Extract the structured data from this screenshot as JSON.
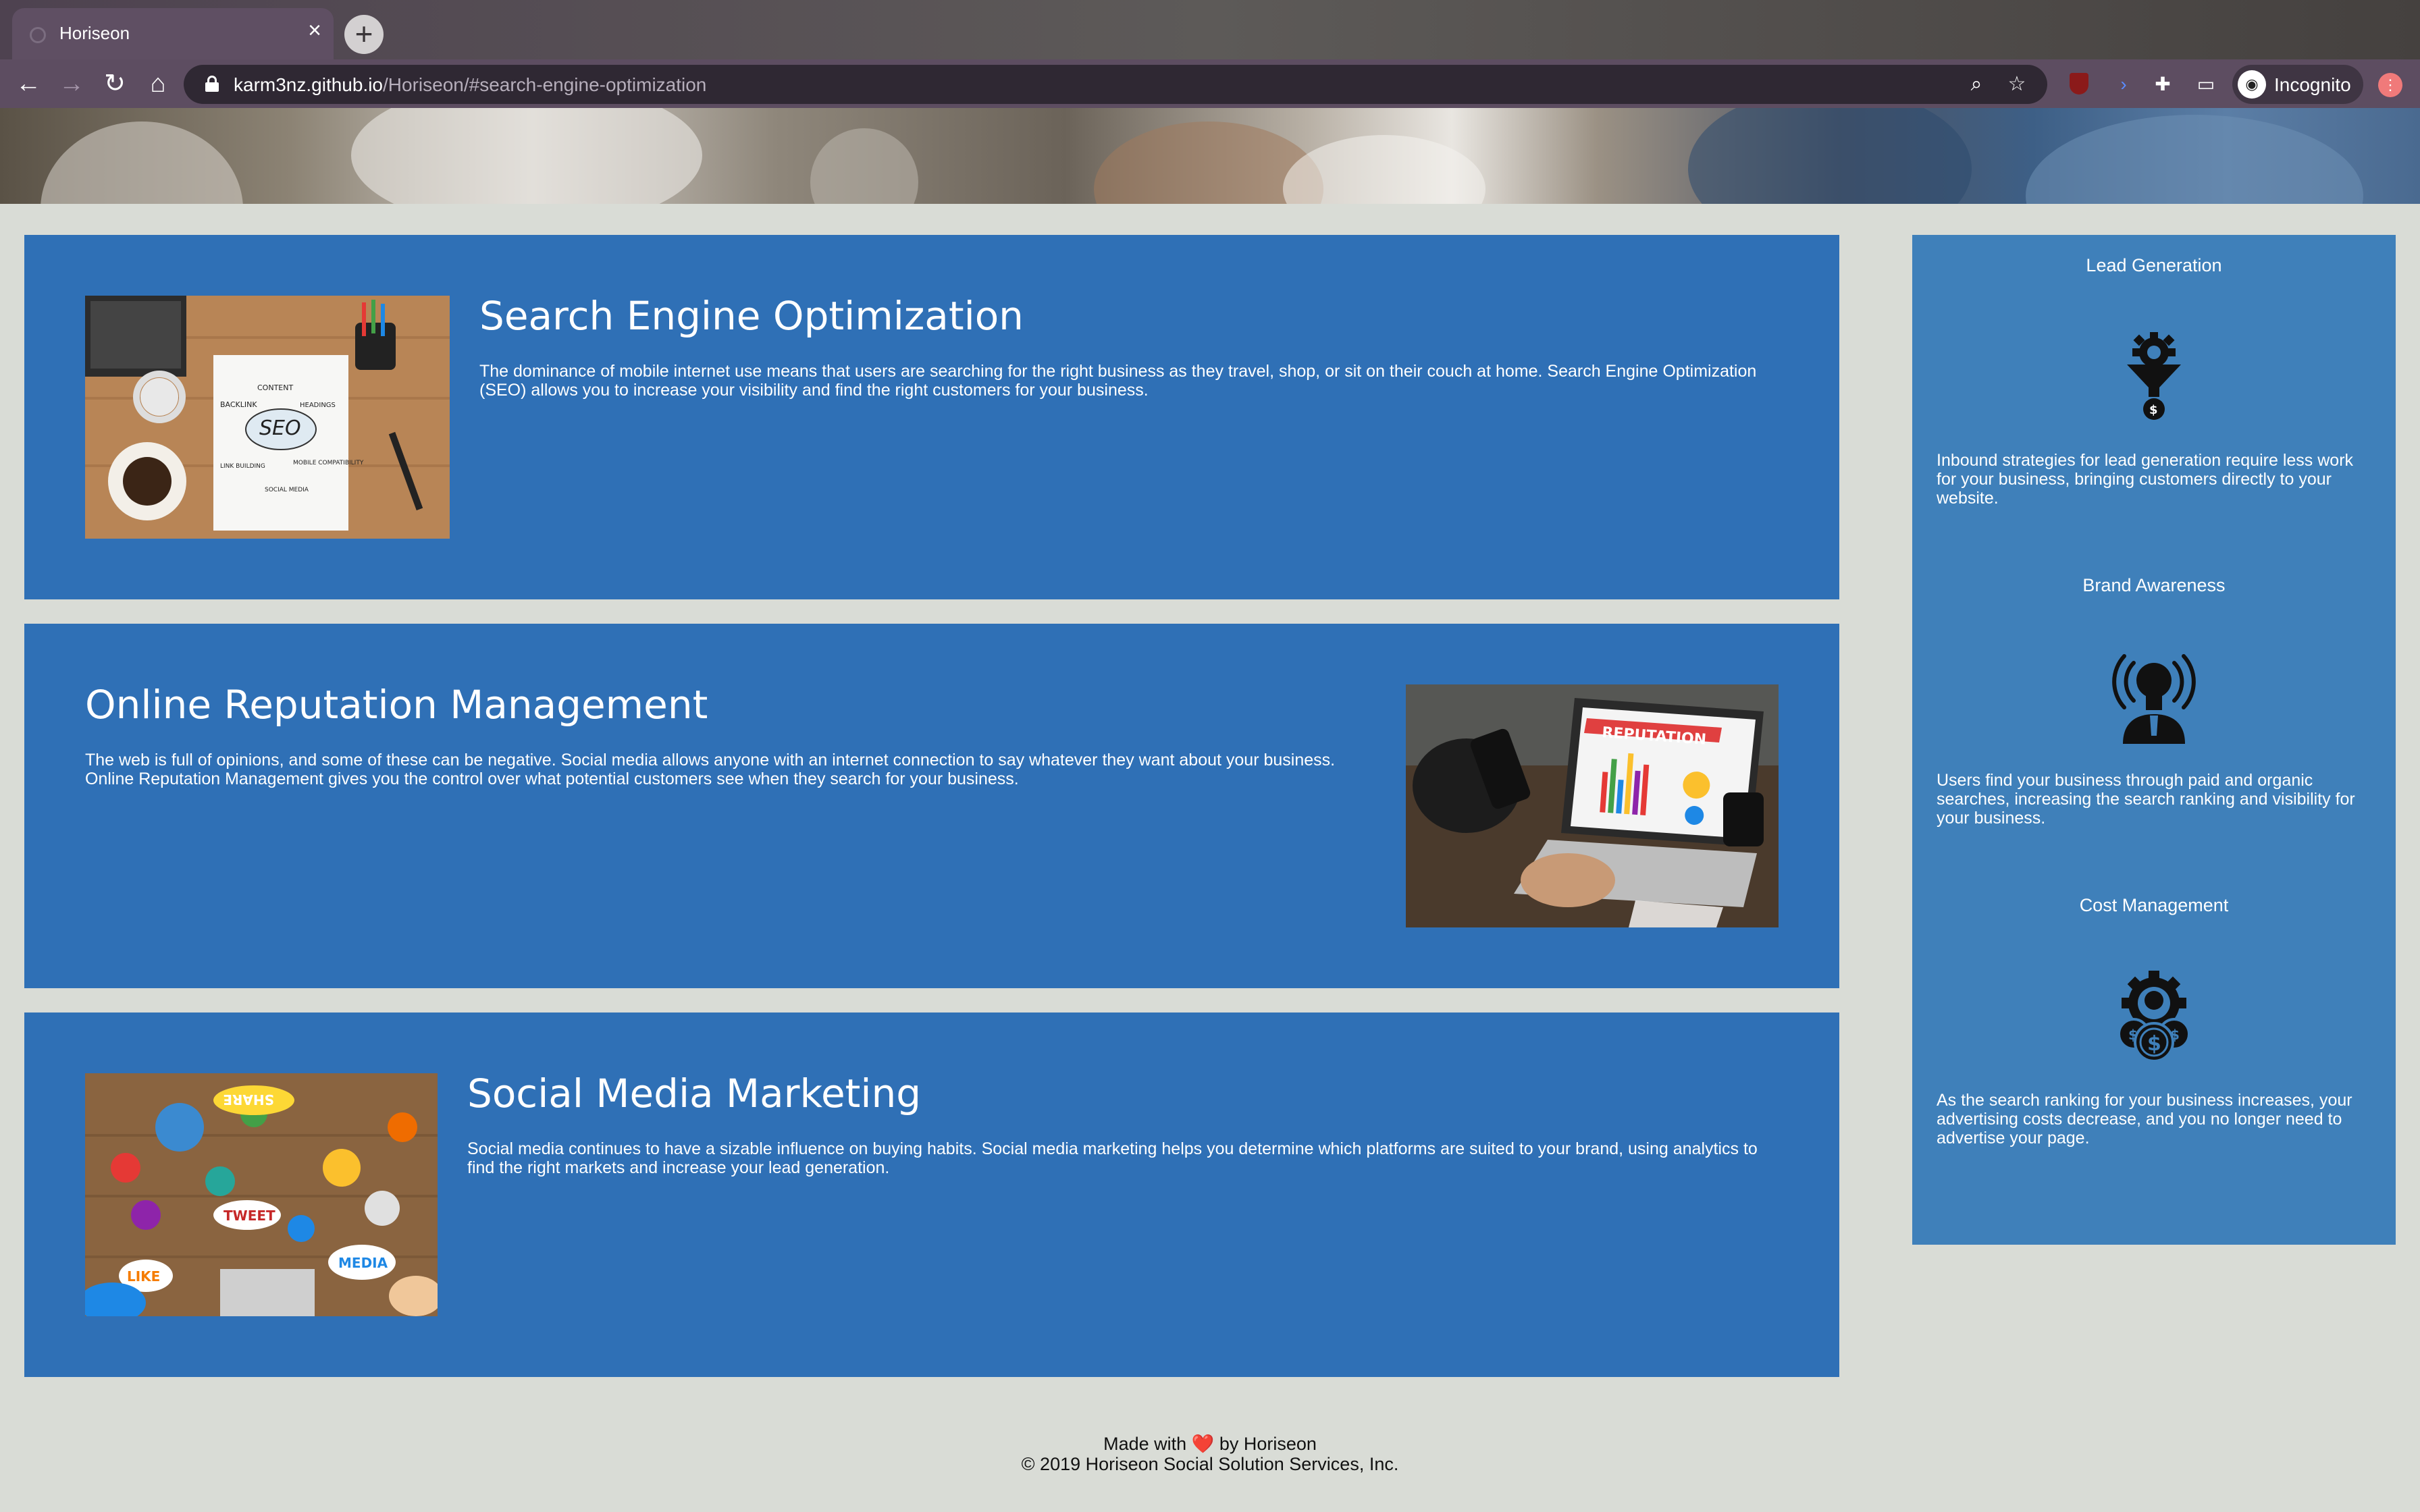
{
  "browser": {
    "tab_title": "Horiseon",
    "url_host": "karm3nz.github.io",
    "url_path": "/Horiseon/#search-engine-optimization",
    "profile_label": "Incognito",
    "icons": [
      "back-arrow-icon",
      "forward-arrow-icon",
      "reload-icon",
      "home-icon",
      "lock-icon",
      "zoom-icon",
      "star-icon",
      "ublock-icon",
      "puzzle-icon",
      "cast-icon",
      "incognito-icon"
    ]
  },
  "content": {
    "seo": {
      "title": "Search Engine Optimization",
      "body": "The dominance of mobile internet use means that users are searching for the right business as they travel, shop, or sit on their couch at home. Search Engine Optimization (SEO) allows you to increase your visibility and find the right customers for your business.",
      "image_labels": [
        "CONTENT",
        "BACKLINK",
        "HEADINGS",
        "SEO",
        "LINK BUILDING",
        "MOBILE COMPATIBILITY",
        "SOCIAL MEDIA"
      ]
    },
    "orm": {
      "title": "Online Reputation Management",
      "body": "The web is full of opinions, and some of these can be negative. Social media allows anyone with an internet connection to say whatever they want about your business. Online Reputation Management gives you the control over what potential customers see when they search for your business.",
      "image_label": "REPUTATION"
    },
    "smm": {
      "title": "Social Media Marketing",
      "body": "Social media continues to have a sizable influence on buying habits. Social media marketing helps you determine which platforms are suited to your brand, using analytics to find the right markets and increase your lead generation.",
      "image_labels": [
        "SHARE",
        "TWEET",
        "LIKE",
        "MEDIA"
      ]
    }
  },
  "benefits": {
    "lead": {
      "title": "Lead Generation",
      "icon": "funnel-gear-dollar-icon",
      "body": "Inbound strategies for lead generation require less work for your business, bringing customers directly to your website."
    },
    "brand": {
      "title": "Brand Awareness",
      "icon": "lightbulb-broadcast-icon",
      "body": "Users find your business through paid and organic searches, increasing the search ranking and visibility for your business."
    },
    "cost": {
      "title": "Cost Management",
      "icon": "gear-coins-icon",
      "body": "As the search ranking for your business increases, your advertising costs decrease, and you no longer need to advertise your page."
    }
  },
  "footer": {
    "made_with": "Made with",
    "heart": "❤️",
    "by": "by Horiseon",
    "copyright": "© 2019 Horiseon Social Solution Services, Inc."
  },
  "colors": {
    "page_bg": "#d9dcd6",
    "content_card": "#2f70b6",
    "sidebar": "#3f80ba",
    "browser_tab": "#5f4f63"
  }
}
